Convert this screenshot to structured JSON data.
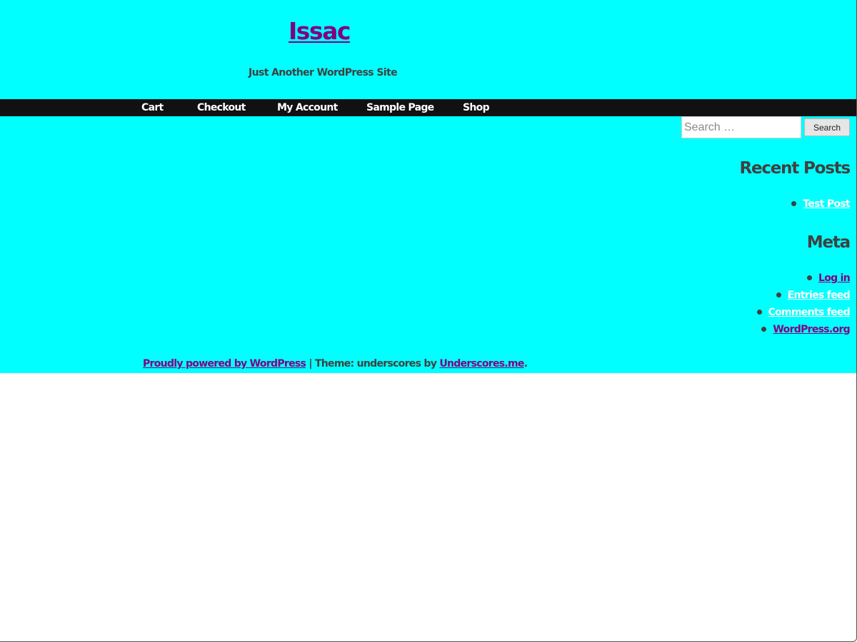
{
  "header": {
    "site_title": "Issac",
    "site_description": "Just Another WordPress Site"
  },
  "nav": {
    "items": [
      {
        "label": "Cart"
      },
      {
        "label": "Checkout"
      },
      {
        "label": "My Account"
      },
      {
        "label": "Sample Page"
      },
      {
        "label": "Shop"
      }
    ]
  },
  "search": {
    "placeholder": "Search …",
    "value": "",
    "button_label": "Search"
  },
  "sidebar": {
    "recent_posts": {
      "title": "Recent Posts",
      "items": [
        {
          "label": "Test Post"
        }
      ]
    },
    "meta": {
      "title": "Meta",
      "items": [
        {
          "label": "Log in"
        },
        {
          "label": "Entries feed"
        },
        {
          "label": "Comments feed"
        },
        {
          "label": "WordPress.org"
        }
      ]
    }
  },
  "footer": {
    "powered_by_link": "Proudly powered by WordPress",
    "separator": " | Theme: underscores by ",
    "theme_author_link": "Underscores.me",
    "end_punct": "."
  },
  "colors": {
    "background": "#00ffff",
    "nav_background": "#111111",
    "visited_link": "#800080",
    "text": "#404040",
    "nav_text": "#ffffff"
  }
}
